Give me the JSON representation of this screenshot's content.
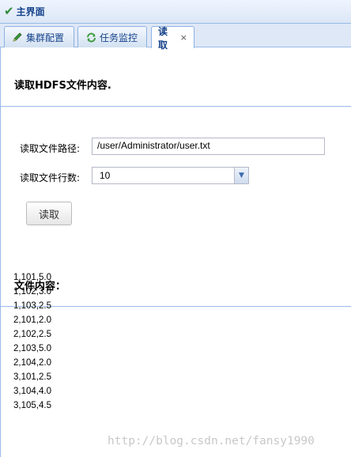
{
  "window": {
    "title": "主界面",
    "title_icon": "check-icon"
  },
  "tabs": [
    {
      "label": "集群配置",
      "icon": "pencil-icon",
      "active": false
    },
    {
      "label": "任务监控",
      "icon": "refresh-icon",
      "active": false
    },
    {
      "label": "读取",
      "active": true,
      "closable": true,
      "close_glyph": "×"
    }
  ],
  "main": {
    "heading": "读取HDFS文件内容.",
    "path_label": "读取文件路径:",
    "path_value": "/user/Administrator/user.txt",
    "rows_label": "读取文件行数:",
    "rows_value": "10",
    "read_button": "读取",
    "content_heading": "文件内容：",
    "content_lines": [
      "1,101,5.0",
      "1,102,3.0",
      "1,103,2.5",
      "2,101,2.0",
      "2,102,2.5",
      "2,103,5.0",
      "2,104,2.0",
      "3,101,2.5",
      "3,104,4.0",
      "3,105,4.5"
    ]
  },
  "watermark": "http://blog.csdn.net/fansy1990",
  "colors": {
    "accent_border": "#99bbe8",
    "tab_text": "#15428b",
    "check_green": "#2e8b3a"
  }
}
